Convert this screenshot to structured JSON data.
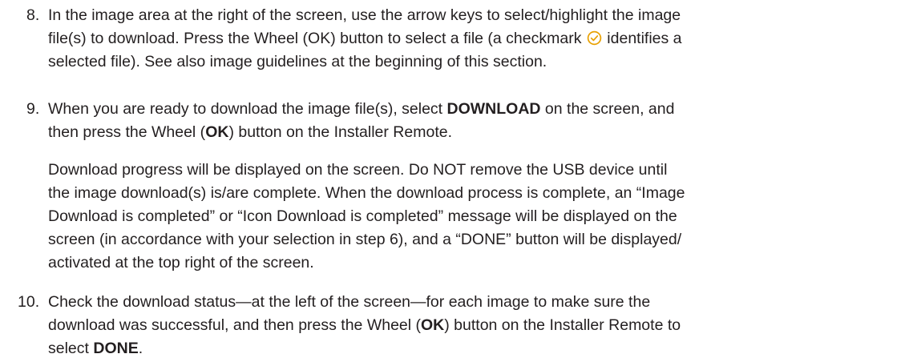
{
  "steps": [
    {
      "number": "8.",
      "text_a": "In the image area at the right of the screen, use the arrow keys to select/highlight the image",
      "text_b": "file(s) to download. Press the Wheel (OK) button to select a file (a checkmark",
      "text_c": "identifies a",
      "text_d": "selected file). See also image guidelines at the beginning of this section."
    },
    {
      "number": "9.",
      "l1_a": "When you are ready to download the image file(s), select ",
      "l1_b": "DOWNLOAD",
      "l1_c": " on the screen, and",
      "l2_a": "then press the Wheel (",
      "l2_b": "OK",
      "l2_c": ") button on the Installer Remote.",
      "para2_l1": "Download progress will be displayed on the screen. Do NOT remove the USB device until",
      "para2_l2": "the image download(s) is/are complete. When the download process is complete, an “Image",
      "para2_l3": "Download is completed” or “Icon Download is completed” message will be displayed on the",
      "para2_l4": "screen (in accordance with your selection in step 6), and a “DONE” button will be displayed/",
      "para2_l5": "activated at the top right of the screen."
    },
    {
      "number": "10.",
      "l1": "Check the download status—at the left of the screen—for each image to make sure the",
      "l2_a": "download was successful, and then press the Wheel (",
      "l2_b": "OK",
      "l2_c": ") button on the Installer Remote to",
      "l3_a": "select ",
      "l3_b": "DONE",
      "l3_c": "."
    }
  ],
  "icons": {
    "checkmark": "checkmark-circle-icon",
    "accent_color": "#e8a000"
  }
}
